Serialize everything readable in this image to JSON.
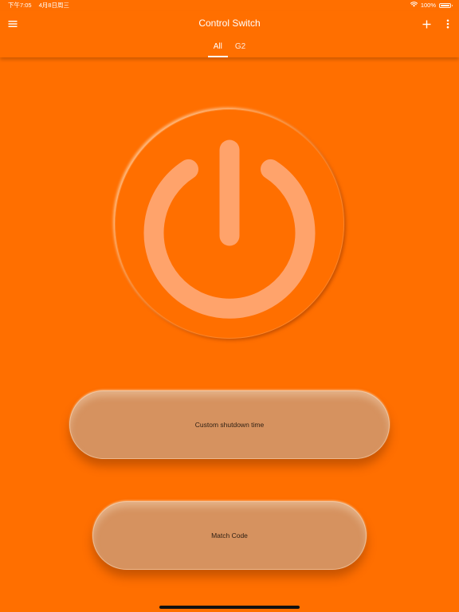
{
  "status_bar": {
    "time": "下午7:05",
    "date": "4月8日周三",
    "battery": "100%",
    "battery_level": 1.0,
    "wifi_icon": "wifi-icon",
    "battery_icon": "battery-icon"
  },
  "app_bar": {
    "title": "Control Switch",
    "menu_icon": "hamburger-menu-icon",
    "add_icon": "plus-icon",
    "more_icon": "more-vertical-icon"
  },
  "tabs": [
    {
      "label": "All",
      "active": true
    },
    {
      "label": "G2",
      "active": false
    }
  ],
  "power_button": {
    "icon": "power-icon"
  },
  "actions": {
    "shutdown_label": "Custom shutdown time",
    "match_label": "Match Code"
  },
  "colors": {
    "background": "#ff6f00",
    "power_icon": "#ffa36b",
    "pill": "#d6925f",
    "pill_text": "#2d1e12"
  }
}
